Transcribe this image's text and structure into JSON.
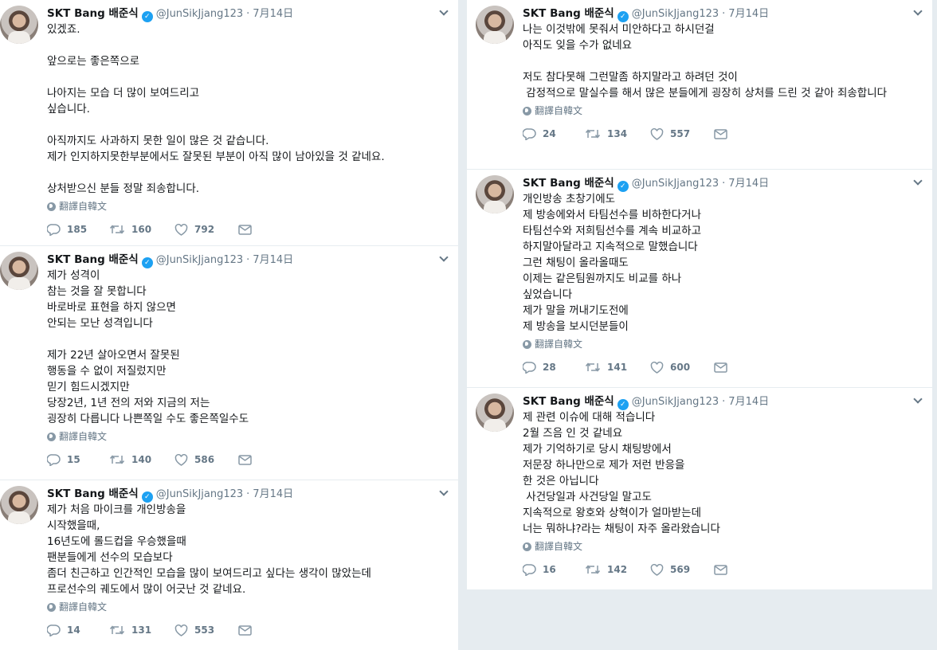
{
  "author": {
    "name": "SKT Bang 배준식",
    "handle": "@JunSikJjang123",
    "separator": "·"
  },
  "translate_label": "翻譯自韓文",
  "left_tweets": [
    {
      "date": "7月14日",
      "text": "있겠죠.\n\n앞으로는 좋은쪽으로\n\n나아지는 모습 더 많이 보여드리고\n싶습니다.\n\n아직까지도 사과하지 못한 일이 많은 것 같습니다.\n제가 인지하지못한부분에서도 잘못된 부분이 아직 많이 남아있을 것 같네요.\n\n상처받으신 분들 정말 죄송합니다.",
      "replies": "185",
      "retweets": "160",
      "likes": "792"
    },
    {
      "date": "7月14日",
      "text": "제가 성격이\n참는 것을 잘 못합니다\n바로바로 표현을 하지 않으면\n안되는 모난 성격입니다\n\n제가 22년 살아오면서 잘못된\n행동을 수 없이 저질렀지만\n믿기 힘드시겠지만\n당장2년, 1년 전의 저와 지금의 저는\n굉장히 다릅니다 나쁜쪽일 수도 좋은쪽일수도",
      "replies": "15",
      "retweets": "140",
      "likes": "586"
    },
    {
      "date": "7月14日",
      "text": "제가 처음 마이크를 개인방송을\n시작했을때,\n16년도에 롤드컵을 우승했을때\n팬분들에게 선수의 모습보다\n좀더 친근하고 인간적인 모습을 많이 보여드리고 싶다는 생각이 많았는데\n프로선수의 궤도에서 많이 어긋난 것 같네요.",
      "replies": "14",
      "retweets": "131",
      "likes": "553"
    }
  ],
  "right_tweets": [
    {
      "date": "7月14日",
      "text": "나는 이것밖에 못줘서 미안하다고 하시던걸\n아직도 잊을 수가 없네요\n\n저도 참다못해 그런말좀 하지말라고 하려던 것이\n 감정적으로 말실수를 해서 많은 분들에게 굉장히 상처를 드린 것 같아 죄송합니다",
      "replies": "24",
      "retweets": "134",
      "likes": "557"
    },
    {
      "date": "7月14日",
      "text": "개인방송 초창기에도\n제 방송에와서 타팀선수를 비하한다거나\n타팀선수와 저희팀선수를 계속 비교하고\n하지말아달라고 지속적으로 말했습니다\n그런 채팅이 올라올때도\n이제는 같은팀원까지도 비교를 하나\n싶었습니다\n제가 말을 꺼내기도전에\n제 방송을 보시던분들이",
      "replies": "28",
      "retweets": "141",
      "likes": "600"
    },
    {
      "date": "7月14日",
      "text": "제 관련 이슈에 대해 적습니다\n2월 즈음 인 것 같네요\n제가 기억하기로 당시 채팅방에서\n저문장 하나만으로 제가 저런 반응을\n한 것은 아닙니다\n 사건당일과 사건당일 말고도\n지속적으로 왕호와 상혁이가 얼마받는데\n너는 뭐하냐?라는 채팅이 자주 올라왔습니다",
      "replies": "16",
      "retweets": "142",
      "likes": "569"
    }
  ]
}
